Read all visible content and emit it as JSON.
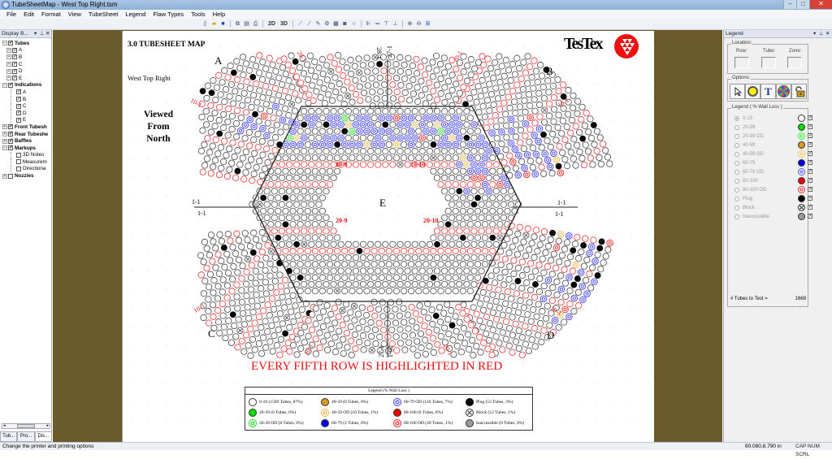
{
  "window": {
    "title": "TubeSheetMap - West Top Right.tsm",
    "controls": {
      "minimize": "–",
      "maximize": "□",
      "close": "✕"
    }
  },
  "menu": [
    "File",
    "Edit",
    "Format",
    "View",
    "TubeSheet",
    "Legend",
    "Flaw Types",
    "Tools",
    "Help"
  ],
  "toolbar": {
    "icons": [
      "new-icon",
      "open-icon",
      "save-icon",
      "copy-icon",
      "paste-icon",
      "print-icon"
    ],
    "view_2d": "2D",
    "view_3d": "3D",
    "icons2": [
      "link-icon",
      "link-icon",
      "wand-icon",
      "gear-icon",
      "table-icon",
      "camera-icon",
      "circle-icon",
      "align-left-icon",
      "align-right-icon",
      "align-top-icon",
      "align-bottom-icon",
      "zoom-in-icon",
      "zoom-out-icon",
      "fit-icon"
    ]
  },
  "left_panel": {
    "title": "Display B...",
    "tree": [
      {
        "label": "Tubes",
        "level": 0,
        "bold": true,
        "checked": true,
        "expander": "−"
      },
      {
        "label": "A",
        "level": 1,
        "checked": true,
        "expander": "+"
      },
      {
        "label": "B",
        "level": 1,
        "checked": true,
        "expander": "+"
      },
      {
        "label": "C",
        "level": 1,
        "checked": true,
        "expander": "+"
      },
      {
        "label": "D",
        "level": 1,
        "checked": true,
        "expander": "+"
      },
      {
        "label": "E",
        "level": 1,
        "checked": true,
        "expander": "+"
      },
      {
        "label": "Indications",
        "level": 0,
        "bold": true,
        "checked": true,
        "expander": "−"
      },
      {
        "label": "A",
        "level": 2,
        "checked": true
      },
      {
        "label": "B",
        "level": 2,
        "checked": true
      },
      {
        "label": "C",
        "level": 2,
        "checked": true
      },
      {
        "label": "D",
        "level": 2,
        "checked": true
      },
      {
        "label": "E",
        "level": 2,
        "checked": true
      },
      {
        "label": "Front Tubesh",
        "level": 0,
        "bold": true,
        "checked": true,
        "expander": "+"
      },
      {
        "label": "Rear Tubeshe",
        "level": 0,
        "bold": true,
        "checked": true,
        "expander": "+"
      },
      {
        "label": "Baffles",
        "level": 0,
        "bold": true,
        "checked": true,
        "expander": "+"
      },
      {
        "label": "Markups",
        "level": 0,
        "bold": true,
        "checked": true,
        "expander": "−"
      },
      {
        "label": "3D Notes",
        "level": 2,
        "checked": false
      },
      {
        "label": "Measurem",
        "level": 2,
        "checked": false
      },
      {
        "label": "Directiona",
        "level": 2,
        "checked": false
      },
      {
        "label": "Nozzles",
        "level": 0,
        "bold": true,
        "checked": false,
        "expander": "+"
      }
    ],
    "tabs": [
      "Tub...",
      "Pro...",
      "Dis..."
    ],
    "active_tab": 2
  },
  "map": {
    "header": "3.0 TUBESHEET MAP",
    "subtitle": "West Top Right",
    "viewed": [
      "Viewed",
      "From",
      "North"
    ],
    "logo": "TesTex",
    "zones": {
      "A": "A",
      "B": "B",
      "C": "C",
      "D": "D",
      "E": "E"
    },
    "row_labels": {
      "top_left_20": "20-1",
      "top_28": "28-1",
      "top_27": "27-1",
      "top_right_20": "20-1",
      "left_10": "10-1",
      "right_10": "10-1",
      "mid_left_1a": "1-1",
      "mid_left_1b": "1-1",
      "mid_right_1a": "1-1",
      "mid_right_1b": "1-1",
      "inner_10_9": "10-9",
      "inner_10_10": "10-10",
      "inner_20_9": "20-9",
      "inner_20_10": "20-10",
      "bl_10": "10-1",
      "br_10": "10-1",
      "bottom_left_20": "20-1",
      "bottom_27": "27-1",
      "bottom_26": "26-1",
      "bottom_right_20": "20-1"
    },
    "banner": "EVERY FIFTH ROW IS HIGHLIGHTED IN RED",
    "legend": {
      "title": "Legend (% Wall Loss )",
      "items": [
        {
          "label": "0-19 (1509 Tubes, 87%)",
          "type": "empty"
        },
        {
          "label": "20-39 (0 Tubes, 0%)",
          "type": "green"
        },
        {
          "label": "20-39 OD (8 Tubes, 0%)",
          "type": "green-od"
        },
        {
          "label": "40-59 (0 Tubes, 0%)",
          "type": "orange"
        },
        {
          "label": "40-59 OD (16 Tubes, 1%)",
          "type": "orange-od"
        },
        {
          "label": "60-79 (2 Tubes, 0%)",
          "type": "blue"
        },
        {
          "label": "60-79 OD (116 Tubes, 7%)",
          "type": "blue-od"
        },
        {
          "label": "80-100 (0 Tubes, 0%)",
          "type": "red"
        },
        {
          "label": "80-100 OD (20 Tubes, 1%)",
          "type": "red-od"
        },
        {
          "label": "Plug (53 Tubes, 3%)",
          "type": "plug"
        },
        {
          "label": "Block (12 Tubes, 1%)",
          "type": "block"
        },
        {
          "label": "Inaccessible (0 Tubes, 0%)",
          "type": "inacc"
        }
      ]
    }
  },
  "right_panel": {
    "title": "Legend",
    "location": {
      "group": "Location:",
      "row": "Row:",
      "tube": "Tube:",
      "zone": "Zone:",
      "row_value": "",
      "tube_value": "",
      "zone_value": ""
    },
    "options": {
      "group": "Options:",
      "buttons": [
        "pointer-icon",
        "tube-paint-icon",
        "text-icon",
        "pattern-icon",
        "lock-icon"
      ],
      "text_glyph": "T"
    },
    "legend_group": "Legend ( % Wall Loss )",
    "items": [
      {
        "label": "0-19",
        "selected": true,
        "color": "#ffffff",
        "type": "empty",
        "checked": true
      },
      {
        "label": "20-39",
        "color": "#00dd00",
        "type": "solid",
        "checked": true
      },
      {
        "label": "20-39 OD",
        "color": "#33ee33",
        "type": "od",
        "checked": true
      },
      {
        "label": "40-59",
        "color": "#d89a20",
        "type": "solid",
        "checked": true
      },
      {
        "label": "40-59 OD",
        "color": "#f0c060",
        "type": "od",
        "checked": true
      },
      {
        "label": "60-79",
        "color": "#0000ee",
        "type": "solid",
        "checked": true
      },
      {
        "label": "60-79 OD",
        "color": "#5555ee",
        "type": "od",
        "checked": true
      },
      {
        "label": "80-100",
        "color": "#ee0000",
        "type": "solid",
        "checked": true
      },
      {
        "label": "80-100 OD",
        "color": "#ee3333",
        "type": "od",
        "checked": true
      },
      {
        "label": "Plug",
        "color": "#000000",
        "type": "solid",
        "checked": true
      },
      {
        "label": "Block",
        "color": "#888888",
        "type": "block",
        "checked": true
      },
      {
        "label": "Inaccessible",
        "color": "#999999",
        "type": "solid",
        "checked": true
      }
    ],
    "tubes_to_test_label": "# Tubes to Test =",
    "tubes_to_test_value": "1669"
  },
  "status": {
    "message": "Change the printer and printing options",
    "coords": "80.080,8.790 in",
    "keys": "CAP  NUM  SCRL"
  },
  "colors": {
    "accent_red": "#ee1111",
    "od_blue": "#4444ee",
    "workspace": "#6b5a2a"
  }
}
